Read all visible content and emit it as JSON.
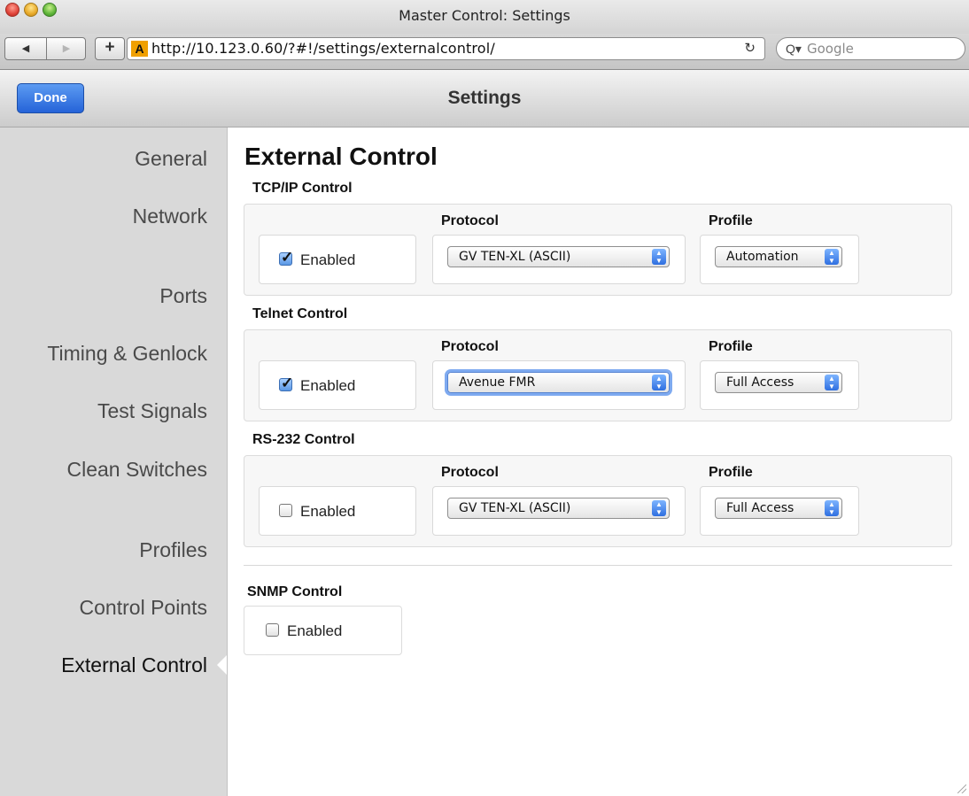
{
  "window": {
    "title": "Master Control: Settings"
  },
  "browser": {
    "back_glyph": "◀",
    "forward_glyph": "▶",
    "add_glyph": "+",
    "favicon_letter": "A",
    "url": "http://10.123.0.60/?#!/settings/externalcontrol/",
    "reload_glyph": "↻",
    "search_icon": "Q▾",
    "search_placeholder": "Google"
  },
  "header": {
    "done_label": "Done",
    "title": "Settings"
  },
  "sidebar": {
    "items": [
      {
        "label": "General"
      },
      {
        "label": "Network"
      },
      {
        "label": "Ports"
      },
      {
        "label": "Timing & Genlock"
      },
      {
        "label": "Test Signals"
      },
      {
        "label": "Clean Switches"
      },
      {
        "label": "Profiles"
      },
      {
        "label": "Control Points"
      },
      {
        "label": "External Control"
      }
    ],
    "selected": "External Control"
  },
  "main": {
    "title": "External Control",
    "sections": [
      {
        "title": "TCP/IP Control",
        "enabled_label": "Enabled",
        "enabled": true,
        "protocol_label": "Protocol",
        "protocol_value": "GV TEN-XL (ASCII)",
        "profile_label": "Profile",
        "profile_value": "Automation"
      },
      {
        "title": "Telnet Control",
        "enabled_label": "Enabled",
        "enabled": true,
        "protocol_label": "Protocol",
        "protocol_value": "Avenue FMR",
        "profile_label": "Profile",
        "profile_value": "Full Access"
      },
      {
        "title": "RS-232 Control",
        "enabled_label": "Enabled",
        "enabled": false,
        "protocol_label": "Protocol",
        "protocol_value": "GV TEN-XL (ASCII)",
        "profile_label": "Profile",
        "profile_value": "Full Access"
      }
    ],
    "snmp": {
      "title": "SNMP Control",
      "enabled_label": "Enabled",
      "enabled": false
    }
  },
  "colors": {
    "accent": "#2563d8",
    "sidebar_bg": "#d9d9d9",
    "checkbox_checked": "#5a97e5"
  }
}
